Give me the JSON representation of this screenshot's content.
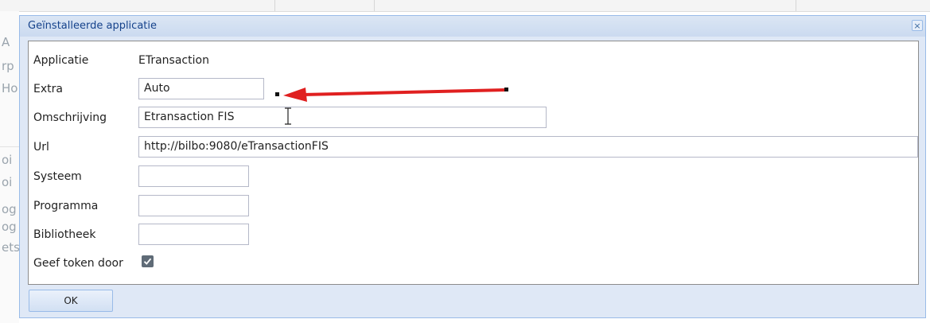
{
  "background": {
    "left_fragments": [
      "A",
      "rp",
      "Ho",
      "oi",
      "oi",
      "og",
      "og",
      "ets"
    ]
  },
  "dialog": {
    "title": "Geïnstalleerde applicatie",
    "close_glyph": "×",
    "fields": {
      "applicatie": {
        "label": "Applicatie",
        "value": "ETransaction"
      },
      "extra": {
        "label": "Extra",
        "value": "Auto"
      },
      "omschrijving": {
        "label": "Omschrijving",
        "value": "Etransaction FIS"
      },
      "url": {
        "label": "Url",
        "value": "http://bilbo:9080/eTransactionFIS"
      },
      "systeem": {
        "label": "Systeem",
        "value": ""
      },
      "programma": {
        "label": "Programma",
        "value": ""
      },
      "bibliotheek": {
        "label": "Bibliotheek",
        "value": ""
      },
      "geef_token": {
        "label": "Geef token door",
        "checked": true
      }
    },
    "ok_label": "OK"
  },
  "annotation": {
    "arrow_color": "#e02020",
    "icon": "red-arrow-icon"
  }
}
